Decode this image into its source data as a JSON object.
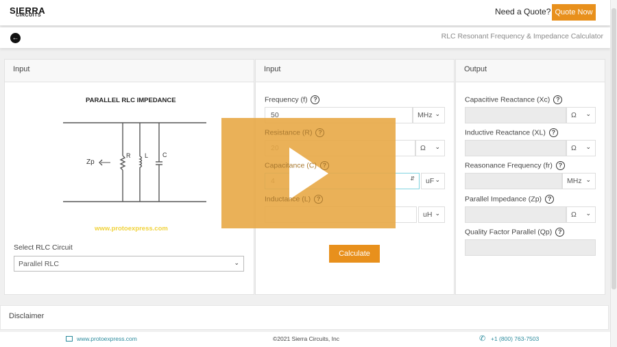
{
  "header": {
    "logo_top": "SIERRA",
    "logo_bottom": "CIRCUITS",
    "quote_text": "Need a Quote?",
    "quote_button": "Quote Now"
  },
  "subheader": {
    "title": "RLC Resonant Frequency & Impedance Calculator",
    "back_icon": "arrow-left-icon"
  },
  "left": {
    "header": "Input",
    "diagram": {
      "title": "PARALLEL RLC IMPEDANCE",
      "zp": "Zp",
      "r": "R",
      "l": "L",
      "c": "C",
      "watermark": "www.protoexpress.com"
    },
    "select_label": "Select RLC Circuit",
    "select_value": "Parallel RLC"
  },
  "middle": {
    "header": "Input",
    "fields": [
      {
        "label": "Frequency (f)",
        "value": "50",
        "unit": "MHz"
      },
      {
        "label": "Resistance (R)",
        "value": "20",
        "unit": "Ω"
      },
      {
        "label": "Capacitance (C)",
        "value": "4",
        "unit": "uF"
      },
      {
        "label": "Inductance (L)",
        "value": "",
        "unit": "uH"
      }
    ],
    "calculate": "Calculate",
    "help": "?"
  },
  "right": {
    "header": "Output",
    "fields": [
      {
        "label": "Capacitive Reactance (Xc)",
        "unit": "Ω"
      },
      {
        "label": "Inductive Reactance (XL)",
        "unit": "Ω"
      },
      {
        "label": "Reasonance Frequency (fr)",
        "unit": "MHz"
      },
      {
        "label": "Parallel Impedance (Zp)",
        "unit": "Ω"
      },
      {
        "label": "Quality Factor Parallel (Qp)"
      }
    ]
  },
  "disclaimer": "Disclaimer",
  "footer": {
    "website": "www.protoexpress.com",
    "copyright": "©2021 Sierra Circuits, Inc",
    "phone": "+1 (800) 763-7503"
  },
  "colors": {
    "accent": "#e8901c",
    "link": "#2a8a9c",
    "focus": "#7fd3e0"
  }
}
